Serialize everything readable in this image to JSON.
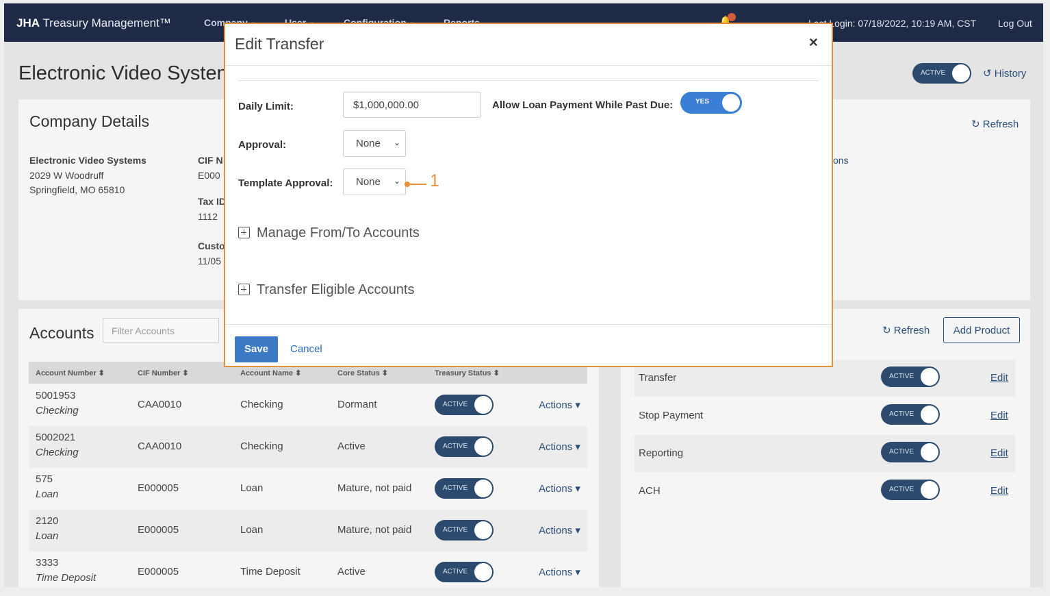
{
  "nav": {
    "brand_bold": "JHA",
    "brand_rest": " Treasury Management™",
    "items": [
      {
        "label": "Company"
      },
      {
        "label": "User"
      },
      {
        "label": "Configuration"
      },
      {
        "label": "Reports"
      }
    ],
    "last_login": "Last Login: 07/18/2022, 10:19 AM, CST",
    "logout": "Log Out"
  },
  "page": {
    "title": "Electronic Video Systems",
    "status_toggle": "ACTIVE",
    "history": "History"
  },
  "company_details": {
    "heading": "Company Details",
    "refresh": "Refresh",
    "name": "Electronic Video Systems",
    "address1": "2029 W Woodruff",
    "address2": "Springfield, MO 65810",
    "cif_label": "CIF N",
    "cif_value": "E000",
    "tax_label": "Tax ID",
    "tax_value": "1112",
    "customer_label": "Custo",
    "customer_value": "11/05",
    "right_partial": "ons"
  },
  "accounts": {
    "heading": "Accounts",
    "filter_placeholder": "Filter Accounts",
    "columns": [
      "Account Number ⬍",
      "CIF Number ⬍",
      "Account Name ⬍",
      "Core Status ⬍",
      "Treasury Status ⬍"
    ],
    "rows": [
      {
        "number": "5001953",
        "type": "Checking",
        "cif": "CAA0010",
        "name": "Checking",
        "core": "Dormant",
        "treasury": "ACTIVE",
        "actions": "Actions ▾"
      },
      {
        "number": "5002021",
        "type": "Checking",
        "cif": "CAA0010",
        "name": "Checking",
        "core": "Active",
        "treasury": "ACTIVE",
        "actions": "Actions ▾"
      },
      {
        "number": "575",
        "type": "Loan",
        "cif": "E000005",
        "name": "Loan",
        "core": "Mature, not paid",
        "treasury": "ACTIVE",
        "actions": "Actions ▾"
      },
      {
        "number": "2120",
        "type": "Loan",
        "cif": "E000005",
        "name": "Loan",
        "core": "Mature, not paid",
        "treasury": "ACTIVE",
        "actions": "Actions ▾"
      },
      {
        "number": "3333",
        "type": "Time Deposit",
        "cif": "E000005",
        "name": "Time Deposit",
        "core": "Active",
        "treasury": "ACTIVE",
        "actions": "Actions ▾"
      }
    ]
  },
  "products": {
    "refresh": "Refresh",
    "add_product": "Add Product",
    "rows": [
      {
        "name": "Transfer",
        "status": "ACTIVE",
        "edit": "Edit"
      },
      {
        "name": "Stop Payment",
        "status": "ACTIVE",
        "edit": "Edit"
      },
      {
        "name": "Reporting",
        "status": "ACTIVE",
        "edit": "Edit"
      },
      {
        "name": "ACH",
        "status": "ACTIVE",
        "edit": "Edit"
      }
    ]
  },
  "modal": {
    "title": "Edit Transfer",
    "close": "×",
    "daily_limit_label": "Daily Limit:",
    "daily_limit_value": "$1,000,000.00",
    "allow_loan_label": "Allow Loan Payment While Past Due:",
    "allow_loan_toggle": "YES",
    "approval_label": "Approval:",
    "approval_value": "None",
    "template_approval_label": "Template Approval:",
    "template_approval_value": "None",
    "callout": "1",
    "section_manage": "Manage From/To Accounts",
    "section_eligible": "Transfer Eligible Accounts",
    "save": "Save",
    "cancel": "Cancel"
  }
}
